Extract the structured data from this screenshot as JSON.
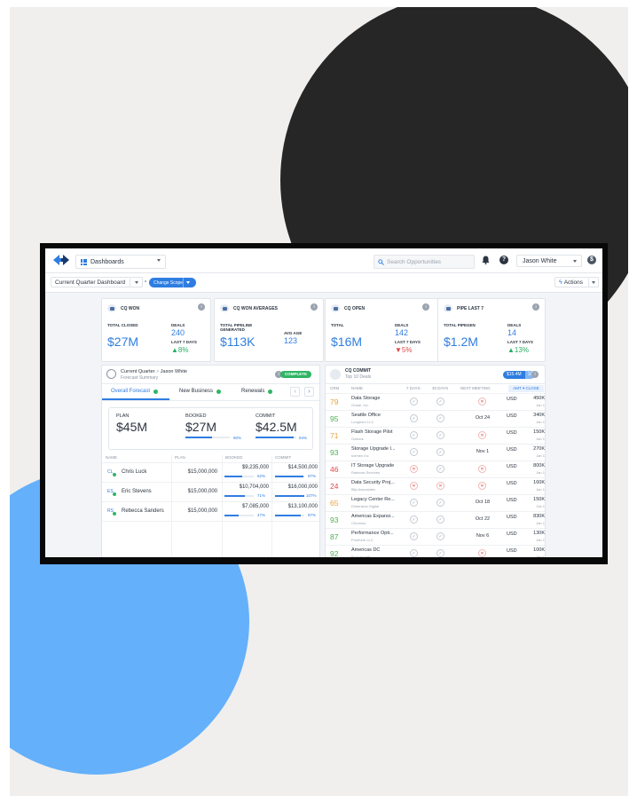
{
  "topbar": {
    "dashboards_label": "Dashboards",
    "search_placeholder": "Search Opportunities",
    "help_glyph": "?",
    "user_name": "Jason White",
    "currency_glyph": "$"
  },
  "subbar": {
    "dashboard_name": "Current Quarter Dashboard",
    "scope_label": "Change Scope",
    "actions_label": "Actions"
  },
  "kpis": {
    "cq_won": {
      "title": "CQ WON",
      "total_label": "TOTAL CLOSED",
      "total": "$27M",
      "deals_label": "DEALS",
      "deals": "240",
      "last7_label": "LAST 7 DAYS",
      "change": "8%"
    },
    "cq_won_avg": {
      "title": "CQ WON AVERAGES",
      "pipeline_label": "TOTAL PIPELINE GENERATED",
      "pipeline": "$113K",
      "avg_age_label": "AVG AGE",
      "avg_age": "123"
    },
    "cq_open": {
      "title": "CQ OPEN",
      "total_label": "TOTAL",
      "total": "$16M",
      "deals_label": "DEALS",
      "deals": "142",
      "last7_label": "LAST 7 DAYS",
      "change": "5%"
    },
    "pipe_last7": {
      "title": "PIPE LAST 7",
      "total_label": "TOTAL PIPEGEN",
      "total": "$1.2M",
      "deals_label": "DEALS",
      "deals": "14",
      "last7_label": "LAST 7 DAYS",
      "change": "13%"
    },
    "info_glyph": "i"
  },
  "forecast": {
    "title": "Current Quarter",
    "crumb_sep": ">",
    "owner": "Jason White",
    "subtitle": "Forecast Summary",
    "status": "COMPLETE",
    "tabs": [
      "Overall Forecast",
      "New Business",
      "Renewals"
    ],
    "prev_glyph": "‹",
    "next_glyph": "›",
    "summary": [
      {
        "label": "PLAN",
        "value": "$45M"
      },
      {
        "label": "BOOKED",
        "value": "$27M",
        "pct": "60%"
      },
      {
        "label": "COMMIT",
        "value": "$42.5M",
        "pct": "94%"
      }
    ],
    "columns": [
      "NAME",
      "PLAN",
      "BOOKED",
      "COMMIT"
    ],
    "rows": [
      {
        "initials": "CL",
        "name": "Chris Luck",
        "plan": "$15,000,000",
        "booked": "$9,235,000",
        "booked_pct": "62%",
        "commit": "$14,500,000",
        "commit_pct": "97%"
      },
      {
        "initials": "ES",
        "name": "Eric Stevens",
        "plan": "$15,000,000",
        "booked": "$10,704,000",
        "booked_pct": "71%",
        "commit": "$16,000,000",
        "commit_pct": "107%"
      },
      {
        "initials": "RS",
        "name": "Rebecca Sanders",
        "plan": "$15,000,000",
        "booked": "$7,085,000",
        "booked_pct": "47%",
        "commit": "$13,100,000",
        "commit_pct": "87%"
      }
    ]
  },
  "commit": {
    "title": "CQ COMMIT",
    "subtitle": "Top 10 Deals",
    "total": "$15.4M",
    "count": "10",
    "columns": [
      "CRM",
      "NAME",
      "7 DAYS",
      "30 DAYS",
      "NEXT MEETING",
      "AMT ▾ CLOSE",
      "USD"
    ],
    "check_glyph": "✓",
    "x_glyph": "✕",
    "rows": [
      {
        "crm": "79",
        "color": "#e8a33d",
        "name": "Data Storage",
        "company": "Grade, Inc.",
        "d7": "ok",
        "d30": "ok",
        "meeting": "",
        "meeting_x": true,
        "cur": "USD",
        "amt": "450K",
        "date": "Jan 1"
      },
      {
        "crm": "95",
        "color": "#4caf50",
        "name": "Seattle Office",
        "company": "Longhorn LLC",
        "d7": "ok",
        "d30": "ok",
        "meeting": "Oct 24",
        "meeting_x": false,
        "cur": "USD",
        "amt": "340K",
        "date": "Jan 1"
      },
      {
        "crm": "71",
        "color": "#e8a33d",
        "name": "Flash Storage Pilot",
        "company": "Outlook",
        "d7": "ok",
        "d30": "ok",
        "meeting": "",
        "meeting_x": true,
        "cur": "USD",
        "amt": "150K",
        "date": "Jan 1"
      },
      {
        "crm": "93",
        "color": "#4caf50",
        "name": "Storage Upgrade I...",
        "company": "Icemen Inc",
        "d7": "ok",
        "d30": "ok",
        "meeting": "Nov 1",
        "meeting_x": false,
        "cur": "USD",
        "amt": "270K",
        "date": "Jan 1"
      },
      {
        "crm": "46",
        "color": "#e04848",
        "name": "IT Storage Upgrade",
        "company": "Rainbow Services",
        "d7": "x",
        "d30": "ok",
        "meeting": "",
        "meeting_x": true,
        "cur": "USD",
        "amt": "800K",
        "date": "Jan 1"
      },
      {
        "crm": "24",
        "color": "#e04848",
        "name": "Data Security Proj...",
        "company": "Blip Associates",
        "d7": "x",
        "d30": "x",
        "meeting": "",
        "meeting_x": true,
        "cur": "USD",
        "amt": "160K",
        "date": "Jan 1"
      },
      {
        "crm": "65",
        "color": "#e8a33d",
        "name": "Legacy Center Re...",
        "company": "Dimension Digital",
        "d7": "ok",
        "d30": "ok",
        "meeting": "Oct 18",
        "meeting_x": false,
        "cur": "USD",
        "amt": "150K",
        "date": "Oct 1"
      },
      {
        "crm": "93",
        "color": "#4caf50",
        "name": "Americas Expansi...",
        "company": "Chromos",
        "d7": "ok",
        "d30": "ok",
        "meeting": "Oct 22",
        "meeting_x": false,
        "cur": "USD",
        "amt": "830K",
        "date": "Jan 1"
      },
      {
        "crm": "87",
        "color": "#4caf50",
        "name": "Performance Opti...",
        "company": "Freeform LLC",
        "d7": "ok",
        "d30": "ok",
        "meeting": "Nov 6",
        "meeting_x": false,
        "cur": "USD",
        "amt": "130K",
        "date": "Jan 1"
      },
      {
        "crm": "92",
        "color": "#4caf50",
        "name": "Americas DC",
        "company": "Buoyant Intl",
        "d7": "ok",
        "d30": "ok",
        "meeting": "",
        "meeting_x": true,
        "cur": "USD",
        "amt": "100K",
        "date": "Jan 1"
      }
    ]
  },
  "colors": {
    "accent": "#2f7de1",
    "success": "#2fb564",
    "danger": "#e04848",
    "warning": "#e8a33d"
  }
}
